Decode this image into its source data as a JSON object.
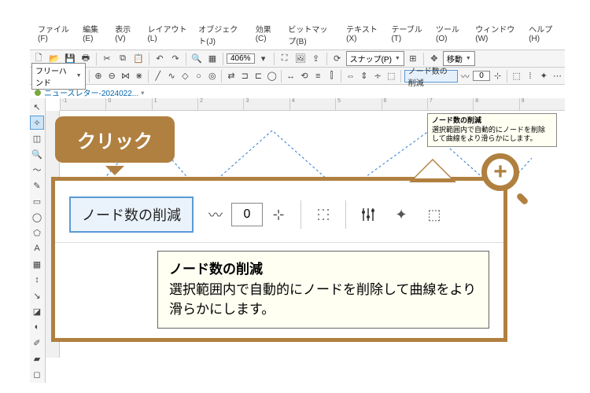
{
  "menu": [
    "ファイル(F)",
    "編集(E)",
    "表示(V)",
    "レイアウト(L)",
    "オブジェクト(J)",
    "効果(C)",
    "ビットマップ(B)",
    "テキスト(X)",
    "テーブル(T)",
    "ツール(O)",
    "ウィンドウ(W)",
    "ヘルプ(H)"
  ],
  "zoom_level": "406%",
  "snap_label": "スナップ(P)",
  "move_label": "移動",
  "freehand_label": "フリーハンド",
  "reduce_nodes_label": "ノード数の削減",
  "reduce_input": "0",
  "doc_tab": "ニュースレター-2024022...",
  "ruler_marks": [
    "-1",
    "0",
    "1",
    "2",
    "3",
    "4",
    "5",
    "6",
    "7",
    "8",
    "9"
  ],
  "tooltip_small": {
    "title": "ノード数の削減",
    "body": "選択範囲内で自動的にノードを削除して曲線をより滑らかにします。"
  },
  "callout": "クリック",
  "zoom_panel": {
    "button": "ノード数の削減",
    "value": "0",
    "tooltip_title": "ノード数の削減",
    "tooltip_body": "選択範囲内で自動的にノードを削除して曲線をより滑らかにします。"
  }
}
